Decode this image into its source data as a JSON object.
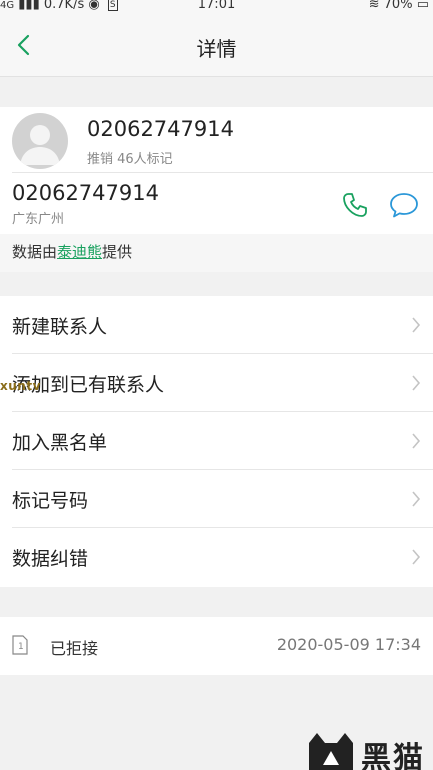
{
  "status_bar": {
    "network": "4G",
    "speed": "0.7K/s",
    "time": "17:01",
    "battery": "70%"
  },
  "header": {
    "title": "详情"
  },
  "contact": {
    "number": "02062747914",
    "tag_text": "推销 46人标记",
    "number_secondary": "02062747914",
    "location": "广东广州"
  },
  "provider": {
    "prefix": "数据由",
    "name": "泰迪熊",
    "suffix": "提供"
  },
  "menu": {
    "items": [
      {
        "label": "新建联系人"
      },
      {
        "label": "添加到已有联系人"
      },
      {
        "label": "加入黑名单"
      },
      {
        "label": "标记号码"
      },
      {
        "label": "数据纠错"
      }
    ]
  },
  "call_log": {
    "sim_slot": "1",
    "status": "已拒接",
    "timestamp": "2020-05-09 17:34"
  },
  "watermark": {
    "left_text": "xuntv",
    "logo_text": "黑猫"
  },
  "colors": {
    "accent": "#19a15f",
    "icon_blue": "#2a97d8",
    "background": "#f1f1f1"
  }
}
